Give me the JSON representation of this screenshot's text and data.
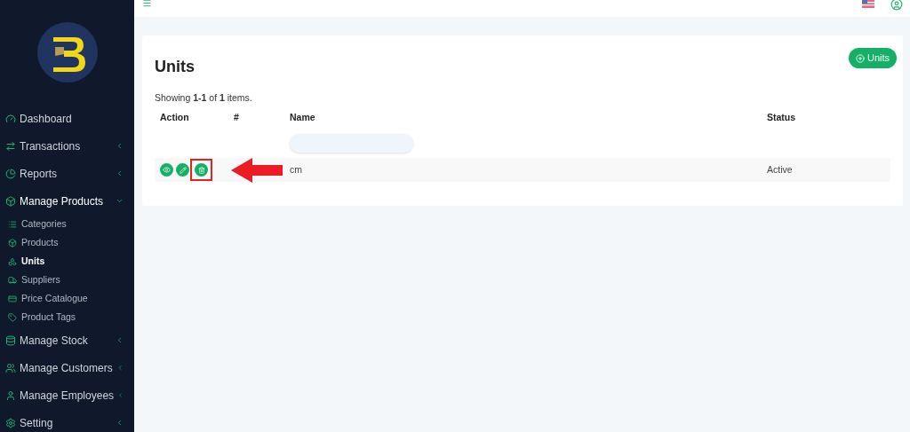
{
  "sidebar": {
    "items": [
      {
        "label": "Dashboard",
        "kind": "link"
      },
      {
        "label": "Transactions",
        "kind": "group",
        "expanded": false
      },
      {
        "label": "Reports",
        "kind": "group",
        "expanded": false
      },
      {
        "label": "Manage Products",
        "kind": "group",
        "expanded": true,
        "children": [
          {
            "label": "Categories",
            "selected": false
          },
          {
            "label": "Products",
            "selected": false
          },
          {
            "label": "Units",
            "selected": true
          },
          {
            "label": "Suppliers",
            "selected": false
          },
          {
            "label": "Price Catalogue",
            "selected": false
          },
          {
            "label": "Product Tags",
            "selected": false
          }
        ]
      },
      {
        "label": "Manage Stock",
        "kind": "group",
        "expanded": false
      },
      {
        "label": "Manage Customers",
        "kind": "group",
        "expanded": false
      },
      {
        "label": "Manage Employees",
        "kind": "group",
        "expanded": false
      },
      {
        "label": "Setting",
        "kind": "group",
        "expanded": false
      }
    ]
  },
  "page": {
    "title": "Units",
    "add_button": "Units",
    "summary": "Showing **1-1** of **1** items."
  },
  "table": {
    "columns": [
      "Action",
      "#",
      "Name",
      "Status"
    ],
    "rows": [
      {
        "cells": [
          "",
          "",
          "cm",
          "Active"
        ]
      }
    ]
  }
}
